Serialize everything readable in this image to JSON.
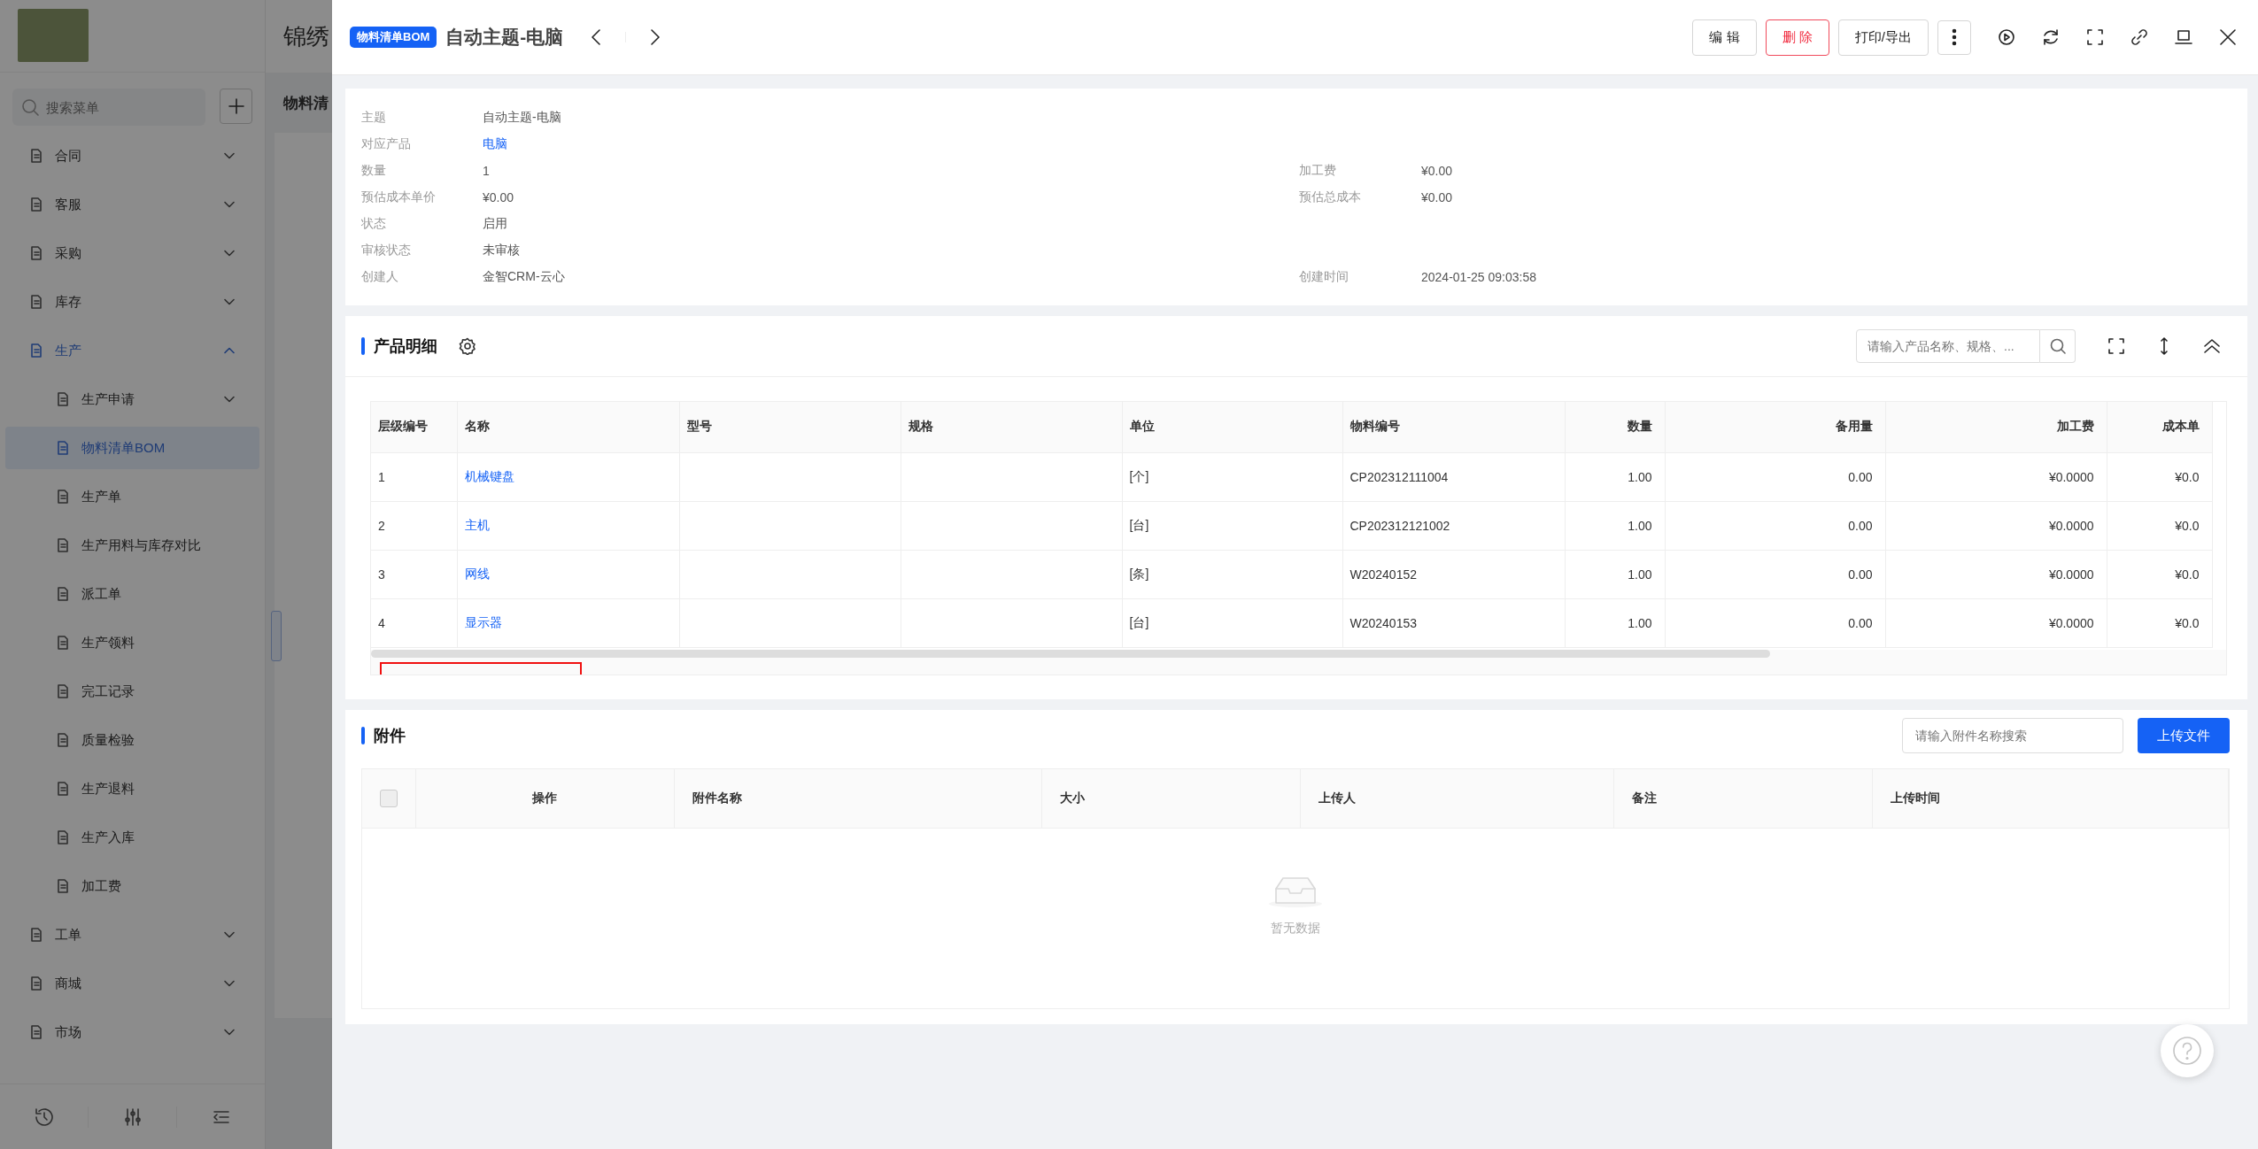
{
  "background_page": {
    "title": "锦绣",
    "breadcrumb": "物料清",
    "search": {
      "placeholder": "搜索菜单"
    },
    "menu": [
      {
        "label": "合同",
        "kind": "group",
        "expanded": false,
        "selected": false
      },
      {
        "label": "客服",
        "kind": "group",
        "expanded": false,
        "selected": false
      },
      {
        "label": "采购",
        "kind": "group",
        "expanded": false,
        "selected": false
      },
      {
        "label": "库存",
        "kind": "group",
        "expanded": false,
        "selected": false
      },
      {
        "label": "生产",
        "kind": "group",
        "expanded": true,
        "selected": true,
        "children": [
          {
            "label": "生产申请",
            "kind": "group",
            "expanded": false,
            "selected": false
          },
          {
            "label": "物料清单BOM",
            "kind": "link",
            "selected": true
          },
          {
            "label": "生产单",
            "kind": "link",
            "selected": false
          },
          {
            "label": "生产用料与库存对比",
            "kind": "link",
            "selected": false
          },
          {
            "label": "派工单",
            "kind": "link",
            "selected": false
          },
          {
            "label": "生产领料",
            "kind": "link",
            "selected": false
          },
          {
            "label": "完工记录",
            "kind": "link",
            "selected": false
          },
          {
            "label": "质量检验",
            "kind": "link",
            "selected": false
          },
          {
            "label": "生产退料",
            "kind": "link",
            "selected": false
          },
          {
            "label": "生产入库",
            "kind": "link",
            "selected": false
          },
          {
            "label": "加工费",
            "kind": "link",
            "selected": false
          }
        ]
      },
      {
        "label": "工单",
        "kind": "group",
        "expanded": false,
        "selected": false
      },
      {
        "label": "商城",
        "kind": "group",
        "expanded": false,
        "selected": false
      },
      {
        "label": "市场",
        "kind": "group",
        "expanded": false,
        "selected": false
      }
    ]
  },
  "drawer": {
    "badge": "物料清单BOM",
    "title": "自动主题-电脑",
    "actions": [
      {
        "label": "编 辑",
        "kind": "default"
      },
      {
        "label": "删 除",
        "kind": "danger"
      },
      {
        "label": "打印/导出",
        "kind": "default"
      }
    ],
    "info": [
      {
        "left": {
          "label": "主题",
          "value": "自动主题-电脑",
          "kind": "text"
        }
      },
      {
        "left": {
          "label": "对应产品",
          "value": "电脑",
          "kind": "link"
        }
      },
      {
        "left": {
          "label": "数量",
          "value": "1",
          "kind": "text"
        },
        "right": {
          "label": "加工费",
          "value": "¥0.00",
          "kind": "text"
        }
      },
      {
        "left": {
          "label": "预估成本单价",
          "value": "¥0.00",
          "kind": "text"
        },
        "right": {
          "label": "预估总成本",
          "value": "¥0.00",
          "kind": "text"
        }
      },
      {
        "left": {
          "label": "状态",
          "value": "启用",
          "kind": "text"
        }
      },
      {
        "left": {
          "label": "审核状态",
          "value": "未审核",
          "kind": "text"
        }
      },
      {
        "left": {
          "label": "创建人",
          "value": "金智CRM-云心",
          "kind": "text"
        },
        "right": {
          "label": "创建时间",
          "value": "2024-01-25 09:03:58",
          "kind": "text"
        }
      }
    ],
    "products": {
      "title": "产品明细",
      "search": {
        "placeholder": "请输入产品名称、规格、..."
      },
      "columns": [
        {
          "label": "层级编号",
          "kind": "text"
        },
        {
          "label": "名称",
          "kind": "link"
        },
        {
          "label": "型号",
          "kind": "text"
        },
        {
          "label": "规格",
          "kind": "text"
        },
        {
          "label": "单位",
          "kind": "text"
        },
        {
          "label": "物料编号",
          "kind": "text"
        },
        {
          "label": "数量",
          "kind": "number"
        },
        {
          "label": "备用量",
          "kind": "number"
        },
        {
          "label": "加工费",
          "kind": "number"
        },
        {
          "label": "成本单",
          "kind": "number"
        }
      ],
      "rows": [
        [
          "1",
          "机械键盘",
          "",
          "",
          "[个]",
          "CP202312111004",
          "1.00",
          "0.00",
          "¥0.0000",
          "¥0.0"
        ],
        [
          "2",
          "主机",
          "",
          "",
          "[台]",
          "CP202312121002",
          "1.00",
          "0.00",
          "¥0.0000",
          "¥0.0"
        ],
        [
          "3",
          "网线",
          "",
          "",
          "[条]",
          "W20240152",
          "1.00",
          "0.00",
          "¥0.0000",
          "¥0.0"
        ],
        [
          "4",
          "显示器",
          "",
          "",
          "[台]",
          "W20240153",
          "1.00",
          "0.00",
          "¥0.0000",
          "¥0.0"
        ]
      ]
    },
    "attachments": {
      "title": "附件",
      "search": {
        "placeholder": "请输入附件名称搜索"
      },
      "upload": "上传文件",
      "select_all": {
        "checked": false
      },
      "columns": [
        {
          "label": "操作",
          "kind": "action"
        },
        {
          "label": "附件名称",
          "kind": "text"
        },
        {
          "label": "大小",
          "kind": "text"
        },
        {
          "label": "上传人",
          "kind": "text"
        },
        {
          "label": "备注",
          "kind": "text"
        },
        {
          "label": "上传时间",
          "kind": "text"
        }
      ],
      "empty": "暂无数据"
    }
  }
}
